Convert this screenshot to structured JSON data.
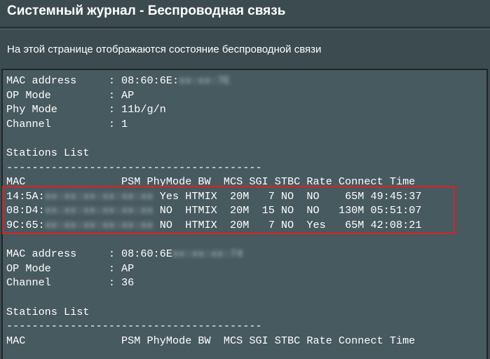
{
  "header": {
    "title": "Системный журнал - Беспроводная связь",
    "description": "На этой странице отображаются состояние беспроводной связи"
  },
  "log": {
    "block1": {
      "mac_line": "MAC address     : 08:60:6E:",
      "mac_hidden": "xx:xx:7E",
      "op_mode": "OP Mode         : AP",
      "phy_mode": "Phy Mode        : 11b/g/n",
      "channel": "Channel         : 1",
      "stations_title": "Stations List",
      "dashes": "----------------------------------------",
      "columns": "MAC               PSM PhyMode BW  MCS SGI STBC Rate Connect Time",
      "stations": [
        {
          "mac_prefix": "14:5A:",
          "mac_hidden": "xx:xx:xx:xx:xx:xx",
          "fields": "Yes HTMIX  20M   7 NO  NO    65M 49:45:37"
        },
        {
          "mac_prefix": "08:D4:",
          "mac_hidden": "xx:xx:xx:xx:xx:xx",
          "fields": "NO  HTMIX  20M  15 NO  NO   130M 05:51:07"
        },
        {
          "mac_prefix": "9C:65:",
          "mac_hidden": "xx:xx:xx:xx:xx:xx",
          "fields": "NO  HTMIX  20M   7 NO  Yes   65M 42:08:21"
        }
      ]
    },
    "block2": {
      "mac_line": "MAC address     : 08:60:6E",
      "mac_hidden": "xx:xx:xx:74",
      "op_mode": "OP Mode         : AP",
      "channel": "Channel         : 36",
      "stations_title": "Stations List",
      "dashes": "----------------------------------------",
      "columns": "MAC               PSM PhyMode BW  MCS SGI STBC Rate Connect Time"
    }
  },
  "colors": {
    "background": "#3b4b50",
    "log_background": "#475a60",
    "highlight": "#e02020"
  }
}
